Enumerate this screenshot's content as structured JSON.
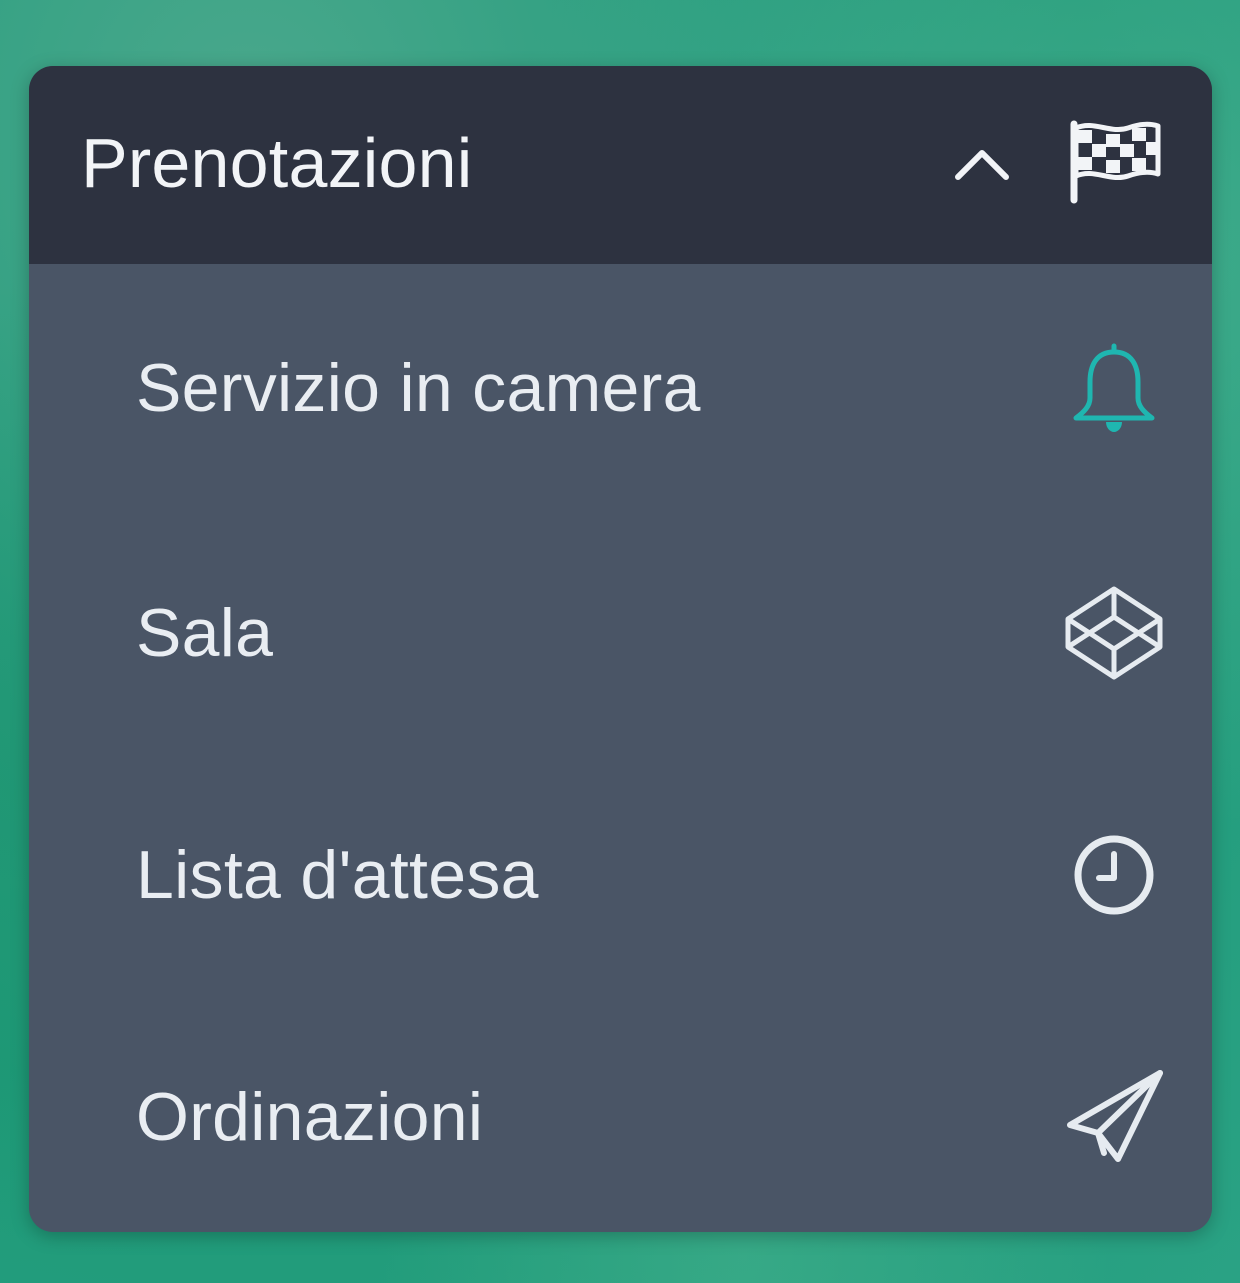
{
  "menu": {
    "title": "Prenotazioni",
    "expanded": true,
    "header_icons": [
      "chevron-up-icon",
      "checkered-flag-icon"
    ],
    "items": [
      {
        "label": "Servizio in camera",
        "icon": "bell-icon",
        "icon_color": "#1fb6b0"
      },
      {
        "label": "Sala",
        "icon": "codepen-cube-icon",
        "icon_color": "#e6ebf0"
      },
      {
        "label": "Lista d'attesa",
        "icon": "clock-icon",
        "icon_color": "#e6ebf0"
      },
      {
        "label": "Ordinazioni",
        "icon": "paper-plane-icon",
        "icon_color": "#e6ebf0"
      }
    ]
  },
  "colors": {
    "header_bg": "#2d3240",
    "panel_bg": "#4a5566",
    "accent": "#1fb6b0",
    "text": "#e9edf2"
  }
}
